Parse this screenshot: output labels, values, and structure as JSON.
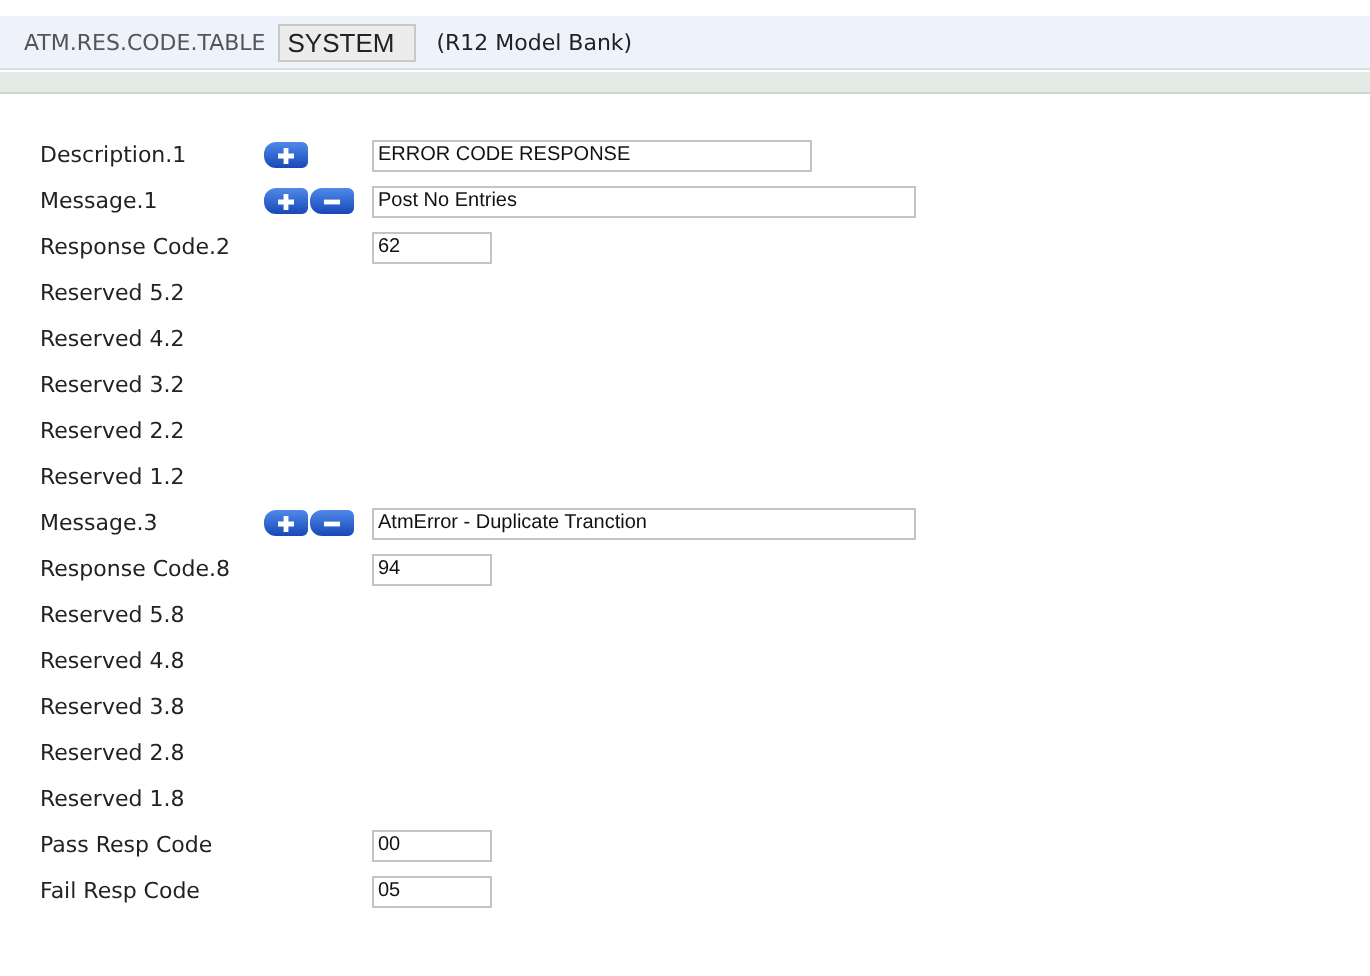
{
  "header": {
    "application": "ATM.RES.CODE.TABLE",
    "record_id": "SYSTEM",
    "company": "(R12 Model Bank)"
  },
  "rows": [
    {
      "kind": "description",
      "label": "Description.1",
      "add": true,
      "remove": false,
      "value": "ERROR CODE RESPONSE"
    },
    {
      "kind": "message",
      "label": "Message.1",
      "add": true,
      "remove": true,
      "value": "Post No Entries"
    },
    {
      "kind": "code",
      "label": "Response Code.2",
      "add": false,
      "remove": false,
      "value": "62"
    },
    {
      "kind": "label",
      "label": "Reserved 5.2",
      "add": false,
      "remove": false
    },
    {
      "kind": "label",
      "label": "Reserved 4.2",
      "add": false,
      "remove": false
    },
    {
      "kind": "label",
      "label": "Reserved 3.2",
      "add": false,
      "remove": false
    },
    {
      "kind": "label",
      "label": "Reserved 2.2",
      "add": false,
      "remove": false
    },
    {
      "kind": "label",
      "label": "Reserved 1.2",
      "add": false,
      "remove": false
    },
    {
      "kind": "message",
      "label": "Message.3",
      "add": true,
      "remove": true,
      "value": "AtmError - Duplicate Tranction"
    },
    {
      "kind": "code",
      "label": "Response Code.8",
      "add": false,
      "remove": false,
      "value": "94"
    },
    {
      "kind": "label",
      "label": "Reserved 5.8",
      "add": false,
      "remove": false
    },
    {
      "kind": "label",
      "label": "Reserved 4.8",
      "add": false,
      "remove": false
    },
    {
      "kind": "label",
      "label": "Reserved 3.8",
      "add": false,
      "remove": false
    },
    {
      "kind": "label",
      "label": "Reserved 2.8",
      "add": false,
      "remove": false
    },
    {
      "kind": "label",
      "label": "Reserved 1.8",
      "add": false,
      "remove": false
    },
    {
      "kind": "code",
      "label": "Pass Resp Code",
      "add": false,
      "remove": false,
      "value": "00"
    },
    {
      "kind": "code",
      "label": "Fail Resp Code",
      "add": false,
      "remove": false,
      "value": "05"
    }
  ]
}
